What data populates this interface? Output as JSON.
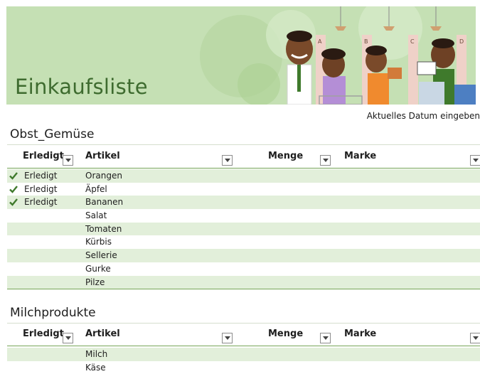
{
  "banner": {
    "title": "Einkaufsliste",
    "shelf_letters": [
      "A",
      "B",
      "C",
      "D"
    ]
  },
  "date_placeholder": "Aktuelles Datum eingeben",
  "columns": {
    "done": "Erledigt",
    "item": "Artikel",
    "qty": "Menge",
    "brand": "Marke"
  },
  "sections": [
    {
      "title": "Obst_Gemüse",
      "rows": [
        {
          "done": "Erledigt",
          "item": "Orangen",
          "checked": true
        },
        {
          "done": "Erledigt",
          "item": "Äpfel",
          "checked": true
        },
        {
          "done": "Erledigt",
          "item": "Bananen",
          "checked": true
        },
        {
          "done": "",
          "item": "Salat",
          "checked": false
        },
        {
          "done": "",
          "item": "Tomaten",
          "checked": false
        },
        {
          "done": "",
          "item": "Kürbis",
          "checked": false
        },
        {
          "done": "",
          "item": "Sellerie",
          "checked": false
        },
        {
          "done": "",
          "item": "Gurke",
          "checked": false
        },
        {
          "done": "",
          "item": "Pilze",
          "checked": false
        }
      ]
    },
    {
      "title": "Milchprodukte",
      "rows": [
        {
          "done": "",
          "item": "Milch",
          "checked": false
        },
        {
          "done": "",
          "item": "Käse",
          "checked": false
        }
      ]
    }
  ],
  "colors": {
    "accent": "#76a557",
    "banner": "#c5e0b4",
    "band": "#e2efda",
    "title": "#3e6b2f"
  }
}
